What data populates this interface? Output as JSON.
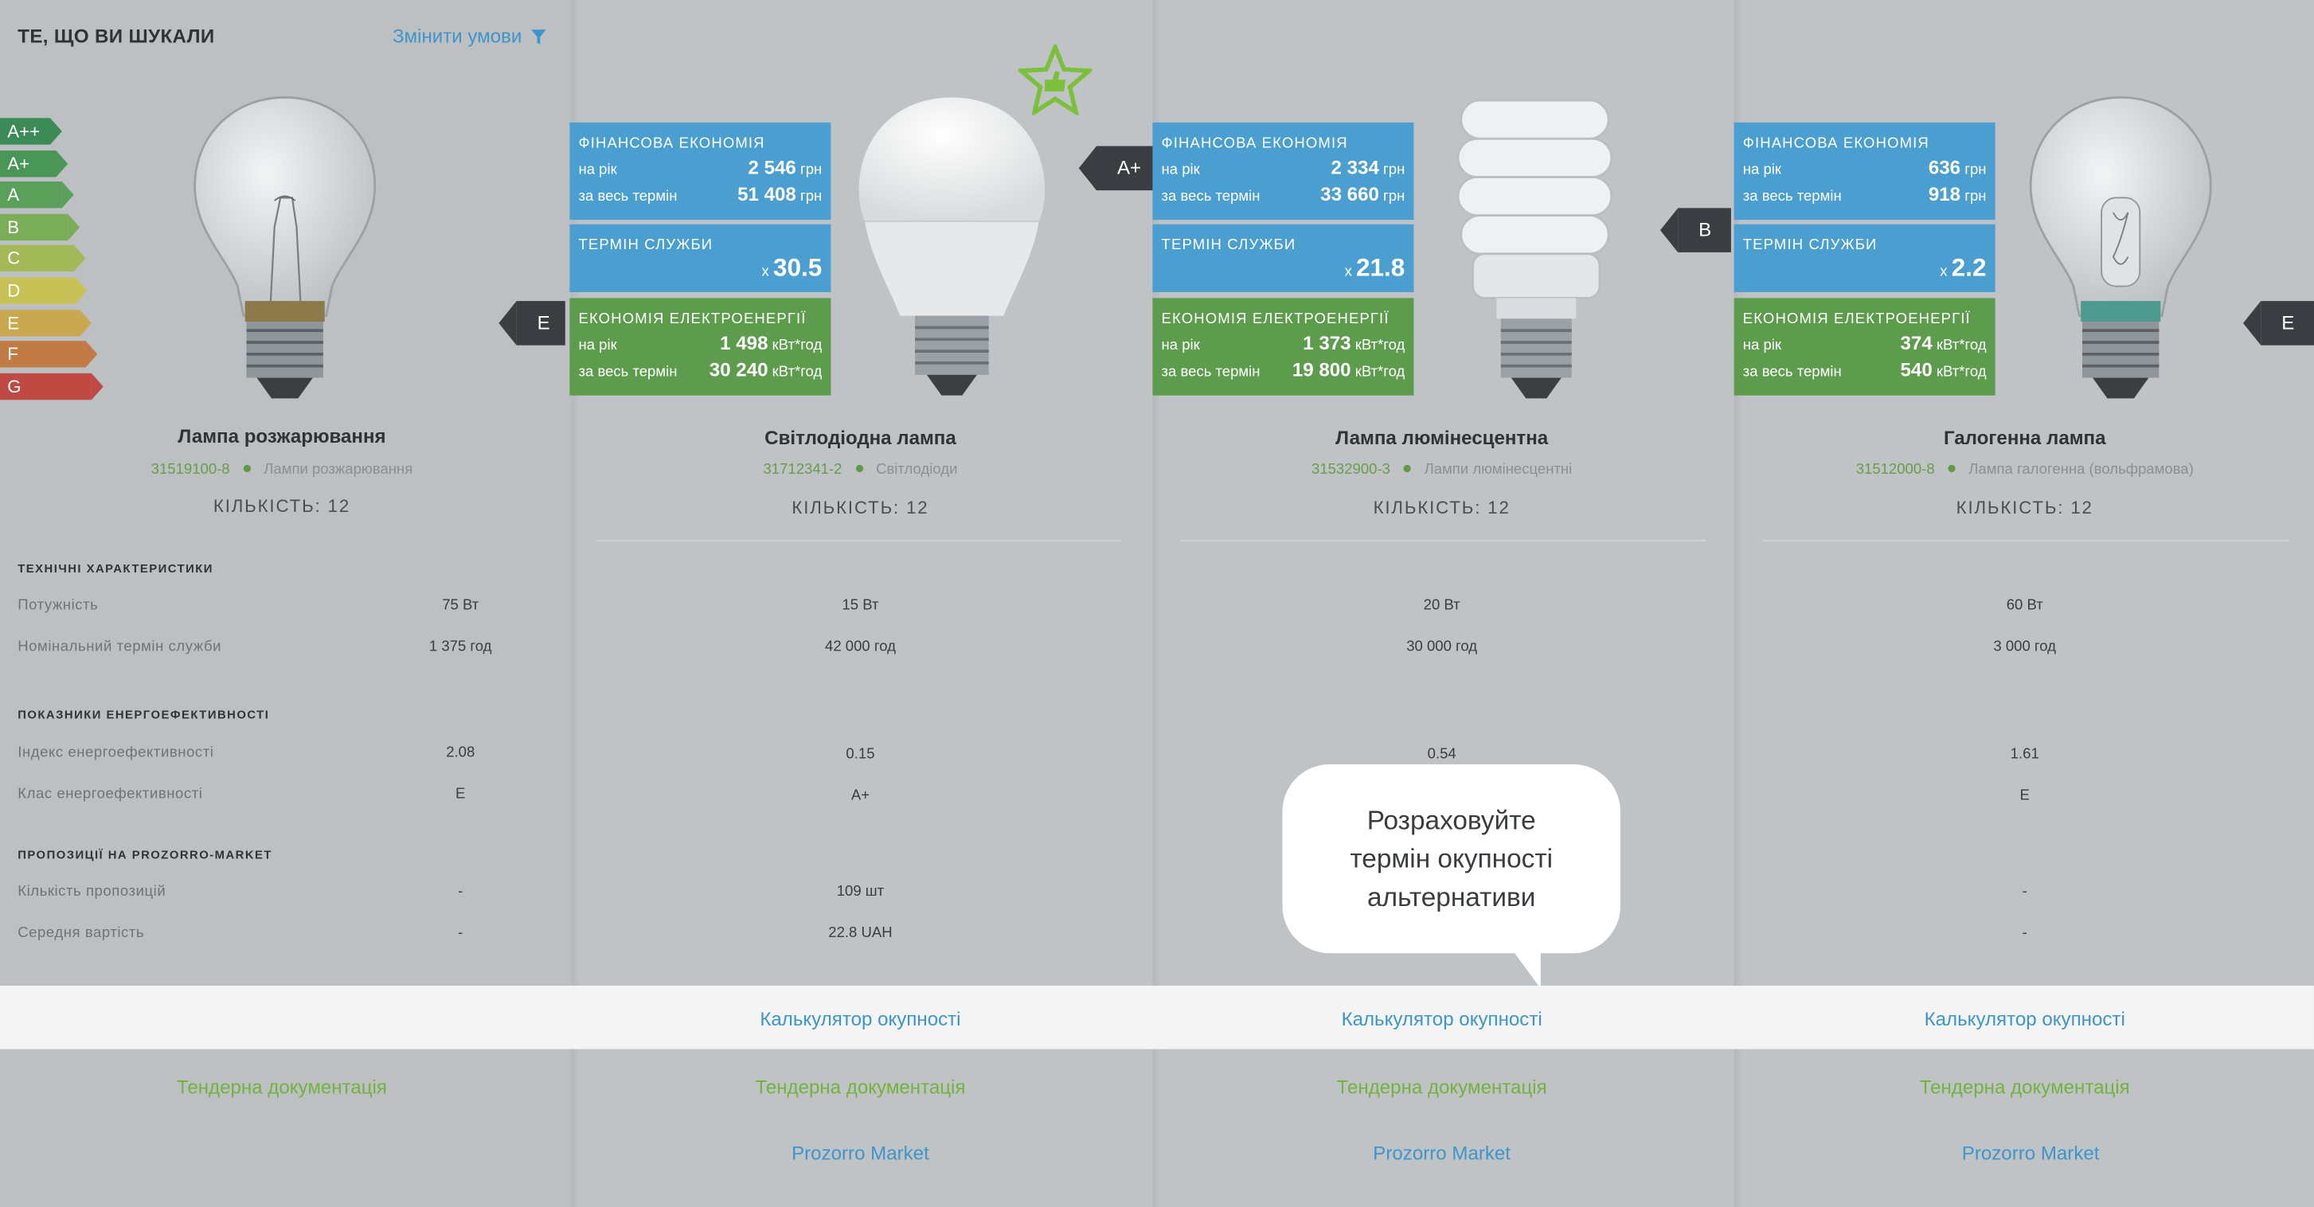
{
  "header": {
    "title": "ТЕ, ЩО ВИ ШУКАЛИ",
    "change_label": "Змінити умови"
  },
  "energy_scale": [
    {
      "label": "A++",
      "color": "#3c8a55"
    },
    {
      "label": "A+",
      "color": "#4a9657"
    },
    {
      "label": "A",
      "color": "#5a9f5a"
    },
    {
      "label": "B",
      "color": "#7aad58"
    },
    {
      "label": "C",
      "color": "#a3b856"
    },
    {
      "label": "D",
      "color": "#c8c256"
    },
    {
      "label": "E",
      "color": "#c9a84f"
    },
    {
      "label": "F",
      "color": "#c27b45"
    },
    {
      "label": "G",
      "color": "#c04a43"
    }
  ],
  "sections": {
    "tech": "ТЕХНІЧНІ ХАРАКТЕРИСТИКИ",
    "power": "Потужність",
    "life": "Номінальний термін служби",
    "eff": "ПОКАЗНИКИ ЕНЕРГОЕФЕКТИВНОСТІ",
    "index": "Індекс енергоефективності",
    "class": "Клас енергоефективності",
    "market": "ПРОПОЗИЦІЇ НА PROZORRO-MARKET",
    "offers": "Кількість пропозицій",
    "avg": "Середня вартість"
  },
  "cards": {
    "fin_title": "ФІНАНСОВА ЕКОНОМІЯ",
    "per_year": "на рік",
    "full_term": "за весь термін",
    "life_title": "ТЕРМІН СЛУЖБИ",
    "energy_title": "ЕКОНОМІЯ ЕЛЕКТРОЕНЕРГІЇ",
    "uah": "грн",
    "kwh": "кВт*год",
    "times": "x"
  },
  "products": [
    {
      "name": "Лампа розжарювання",
      "code": "31519100-8",
      "category": "Лампи розжарювання",
      "qty": "КІЛЬКІСТЬ: 12",
      "badge": "E",
      "power": "75 Вт",
      "life": "1 375 год",
      "index": "2.08",
      "class": "E",
      "offers": "-",
      "avg": "-"
    },
    {
      "name": "Світлодіодна лампа",
      "code": "31712341-2",
      "category": "Світлодіоди",
      "qty": "КІЛЬКІСТЬ: 12",
      "badge": "A+",
      "fin_year": "2 546",
      "fin_total": "51 408",
      "life_x": "30.5",
      "en_year": "1 498",
      "en_total": "30 240",
      "power": "15 Вт",
      "life": "42 000 год",
      "index": "0.15",
      "class": "A+",
      "offers": "109 шт",
      "avg": "22.8 UAH"
    },
    {
      "name": "Лампа люмінесцентна",
      "code": "31532900-3",
      "category": "Лампи люмінесцентні",
      "qty": "КІЛЬКІСТЬ: 12",
      "badge": "B",
      "fin_year": "2 334",
      "fin_total": "33 660",
      "life_x": "21.8",
      "en_year": "1 373",
      "en_total": "19 800",
      "power": "20 Вт",
      "life": "30 000 год",
      "index": "0.54"
    },
    {
      "name": "Галогенна лампа",
      "code": "31512000-8",
      "category": "Лампа галогенна (вольфрамова)",
      "qty": "КІЛЬКІСТЬ: 12",
      "badge": "E",
      "fin_year": "636",
      "fin_total": "918",
      "life_x": "2.2",
      "en_year": "374",
      "en_total": "540",
      "power": "60 Вт",
      "life": "3 000 год",
      "index": "1.61",
      "class": "E",
      "offers": "-",
      "avg": "-"
    }
  ],
  "links": {
    "calc": "Калькулятор окупності",
    "tender": "Тендерна документація",
    "prozorro": "Prozorro Market"
  },
  "tooltip": {
    "line1": "Розраховуйте",
    "line2": "термін окупності",
    "line3": "альтернативи"
  }
}
